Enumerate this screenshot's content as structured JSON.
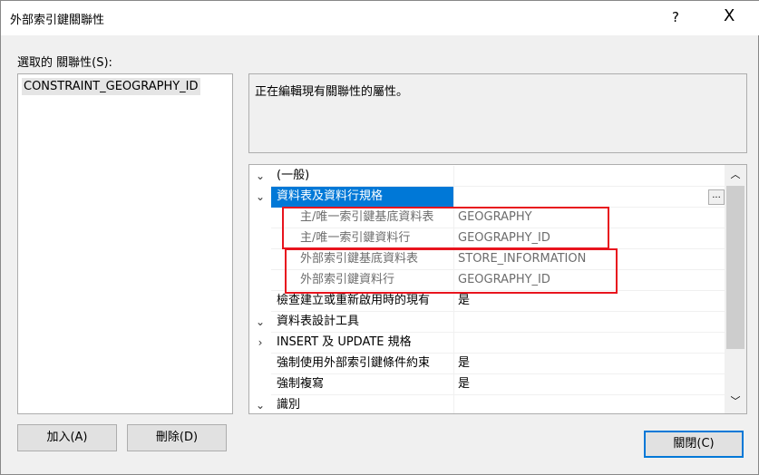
{
  "window": {
    "title": "外部索引鍵關聯性",
    "help": "?",
    "close": "X"
  },
  "selected_label": "選取的 關聯性(S):",
  "list": [
    "CONSTRAINT_GEOGRAPHY_ID"
  ],
  "description": "正在編輯現有關聯性的屬性。",
  "grid": {
    "rows": [
      {
        "name": "(一般)",
        "value": "",
        "type": "category",
        "toggle": "expanded"
      },
      {
        "name": "資料表及資料行規格",
        "value": "",
        "type": "selected",
        "toggle": "expanded"
      },
      {
        "name": "主/唯一索引鍵基底資料表",
        "value": "GEOGRAPHY",
        "type": "sub"
      },
      {
        "name": "主/唯一索引鍵資料行",
        "value": "GEOGRAPHY_ID",
        "type": "sub"
      },
      {
        "name": "外部索引鍵基底資料表",
        "value": "STORE_INFORMATION",
        "type": "sub"
      },
      {
        "name": "外部索引鍵資料行",
        "value": "GEOGRAPHY_ID",
        "type": "sub"
      },
      {
        "name": "檢查建立或重新啟用時的現有",
        "value": "是",
        "type": "prop"
      },
      {
        "name": "資料表設計工具",
        "value": "",
        "type": "category",
        "toggle": "expanded"
      },
      {
        "name": "INSERT 及 UPDATE 規格",
        "value": "",
        "type": "prop",
        "toggle": "collapsed"
      },
      {
        "name": "強制使用外部索引鍵條件約束",
        "value": "是",
        "type": "prop"
      },
      {
        "name": "強制複寫",
        "value": "是",
        "type": "prop"
      },
      {
        "name": "識別",
        "value": "",
        "type": "category",
        "toggle": "expanded"
      }
    ],
    "ellipsis": "...",
    "highlight_color": "#e8141e"
  },
  "buttons": {
    "add": "加入(A)",
    "delete": "刪除(D)",
    "close": "關閉(C)"
  }
}
